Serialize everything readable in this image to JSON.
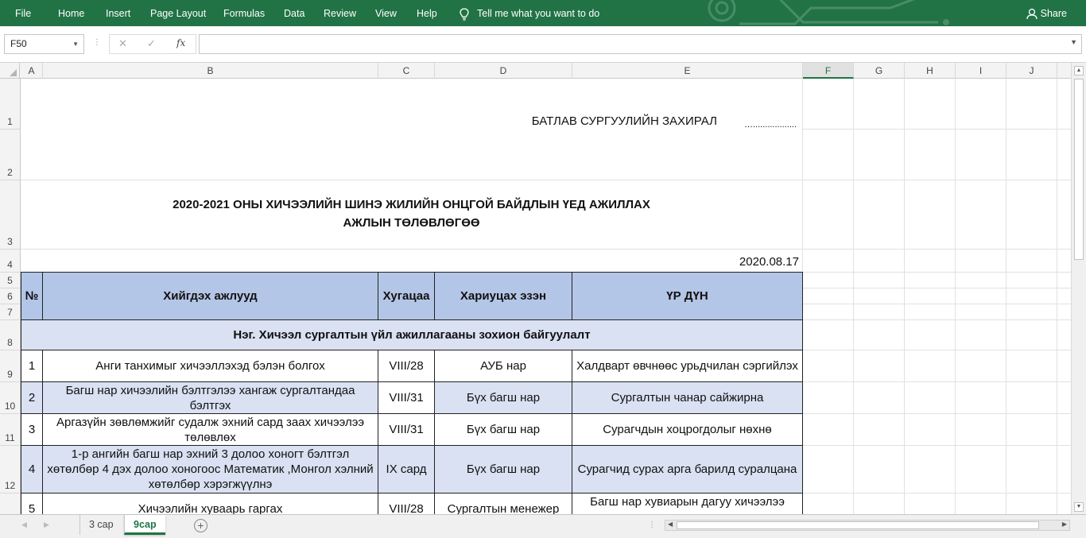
{
  "ribbon": {
    "tabs": [
      "File",
      "Home",
      "Insert",
      "Page Layout",
      "Formulas",
      "Data",
      "Review",
      "View",
      "Help"
    ],
    "tell_me": "Tell me what you want to do",
    "share": "Share",
    "bg_color": "#217346"
  },
  "formula_bar": {
    "name_box": "F50",
    "formula": ""
  },
  "columns": [
    "A",
    "B",
    "C",
    "D",
    "E",
    "F",
    "G",
    "H",
    "I",
    "J"
  ],
  "selected_column": "F",
  "rows": [
    "1",
    "2",
    "3",
    "4",
    "5",
    "6",
    "7",
    "8",
    "9",
    "10",
    "11",
    "12"
  ],
  "sheet": {
    "approve_label": "БАТЛАВ СУРГУУЛИЙН ЗАХИРАЛ",
    "approve_dots": "…..................",
    "title_line1": "2020-2021 ОНЫ ХИЧЭЭЛИЙН ШИНЭ ЖИЛИЙН ОНЦГОЙ БАЙДЛЫН ҮЕД АЖИЛЛАХ",
    "title_line2": "АЖЛЫН ТӨЛӨВЛӨГӨӨ",
    "date": "2020.08.17",
    "headers": {
      "no": "№",
      "task": "Хийгдэх ажлууд",
      "deadline": "Хугацаа",
      "owner": "Хариуцах эзэн",
      "result": "ҮР ДҮН"
    },
    "section1": "Нэг. Хичээл сургалтын үйл ажиллагааны зохион байгуулалт",
    "items": [
      {
        "no": "1",
        "task": "Анги танхимыг хичээллэхэд бэлэн болгох",
        "deadline": "VIII/28",
        "owner": "АУБ нар",
        "result": "Халдварт өвчнөөс урьдчилан сэргийлэх"
      },
      {
        "no": "2",
        "task": "Багш нар хичээлийн бэлтгэлээ хангаж сургалтандаа бэлтгэх",
        "deadline": "VIII/31",
        "owner": "Бүх багш нар",
        "result": "Сургалтын чанар сайжирна"
      },
      {
        "no": "3",
        "task": "Аргазүйн зөвлөмжийг судалж эхний сард заах хичээлээ төлөвлөх",
        "deadline": "VIII/31",
        "owner": "Бүх багш нар",
        "result": "Сурагчдын хоцрогдолыг нөхнө"
      },
      {
        "no": "4",
        "task": "1-р ангийн багш нар  эхний 3 долоо  хоногт бэлтгэл хөтөлбөр 4 дэх долоо хоногоос Математик ,Монгол хэлний хөтөлбөр хэрэгжүүлнэ",
        "deadline": "IX сард",
        "owner": "Бүх багш нар",
        "result": "Сурагчид сурах арга барилд суралцана"
      },
      {
        "no": "5",
        "task": "Хичээлийн хуваарь гаргах",
        "deadline": "VIII/28",
        "owner": "Сургалтын менежер",
        "result": "Багш нар хувиарын дагуу хичээлээ"
      }
    ]
  },
  "sheet_tabs": [
    "3 сар",
    "9сар"
  ],
  "active_tab": "9сар"
}
